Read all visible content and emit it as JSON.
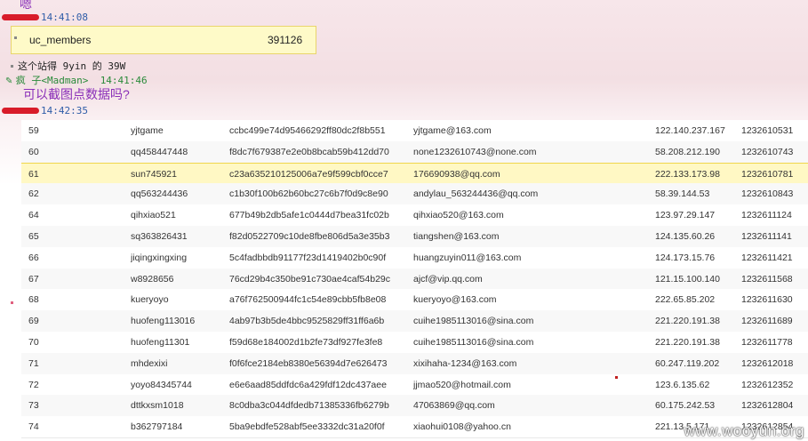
{
  "chat": {
    "top_fragment": "嗯",
    "time1": "14:41:08",
    "uc_box": {
      "name": "uc_members",
      "count": "391126"
    },
    "bullet_msg": "这个站得 9yin 的 39W",
    "madman_nick": "疯  子<Madman>",
    "madman_time": "14:41:46",
    "question": "可以截图点数据吗?",
    "time2": "14:42:35"
  },
  "table": {
    "rows": [
      {
        "id": "59",
        "username": "yjtgame",
        "hash": "ccbc499e74d95466292ff80dc2f8b551",
        "email": "yjtgame@163.com",
        "ip": "122.140.237.167",
        "ts": "1232610531"
      },
      {
        "id": "60",
        "username": "qq458447448",
        "hash": "f8dc7f679387e2e0b8bcab59b412dd70",
        "email": "none1232610743@none.com",
        "ip": "58.208.212.190",
        "ts": "1232610743"
      },
      {
        "id": "61",
        "username": "sun745921",
        "hash": "c23a635210125006a7e9f599cbf0cce7",
        "email": "176690938@qq.com",
        "ip": "222.133.173.98",
        "ts": "1232610781"
      },
      {
        "id": "62",
        "username": "qq563244436",
        "hash": "c1b30f100b62b60bc27c6b7f0d9c8e90",
        "email": "andylau_563244436@qq.com",
        "ip": "58.39.144.53",
        "ts": "1232610843"
      },
      {
        "id": "64",
        "username": "qihxiao521",
        "hash": "677b49b2db5afe1c0444d7bea31fc02b",
        "email": "qihxiao520@163.com",
        "ip": "123.97.29.147",
        "ts": "1232611124"
      },
      {
        "id": "65",
        "username": "sq363826431",
        "hash": "f82d0522709c10de8fbe806d5a3e35b3",
        "email": "tiangshen@163.com",
        "ip": "124.135.60.26",
        "ts": "1232611141"
      },
      {
        "id": "66",
        "username": "jiqingxingxing",
        "hash": "5c4fadbbdb91177f23d1419402b0c90f",
        "email": "huangzuyin011@163.com",
        "ip": "124.173.15.76",
        "ts": "1232611421"
      },
      {
        "id": "67",
        "username": "w8928656",
        "hash": "76cd29b4c350be91c730ae4caf54b29c",
        "email": "ajcf@vip.qq.com",
        "ip": "121.15.100.140",
        "ts": "1232611568"
      },
      {
        "id": "68",
        "username": "kueryoyo",
        "hash": "a76f762500944fc1c54e89cbb5fb8e08",
        "email": "kueryoyo@163.com",
        "ip": "222.65.85.202",
        "ts": "1232611630"
      },
      {
        "id": "69",
        "username": "huofeng113016",
        "hash": "4ab97b3b5de4bbc9525829ff31ff6a6b",
        "email": "cuihe1985113016@sina.com",
        "ip": "221.220.191.38",
        "ts": "1232611689"
      },
      {
        "id": "70",
        "username": "huofeng11301",
        "hash": "f59d68e184002d1b2fe73df927fe3fe8",
        "email": "cuihe1985113016@sina.com",
        "ip": "221.220.191.38",
        "ts": "1232611778"
      },
      {
        "id": "71",
        "username": "mhdexixi",
        "hash": "f0f6fce2184eb8380e56394d7e626473",
        "email": "xixihaha-1234@163.com",
        "ip": "60.247.119.202",
        "ts": "1232612018"
      },
      {
        "id": "72",
        "username": "yoyo84345744",
        "hash": "e6e6aad85ddfdc6a429fdf12dc437aee",
        "email": "jjmao520@hotmail.com",
        "ip": "123.6.135.62",
        "ts": "1232612352"
      },
      {
        "id": "73",
        "username": "dttkxsm1018",
        "hash": "8c0dba3c044dfdedb71385336fb6279b",
        "email": "47063869@qq.com",
        "ip": "60.175.242.53",
        "ts": "1232612804"
      },
      {
        "id": "74",
        "username": "b362797184",
        "hash": "5ba9ebdfe528abf5ee3332dc31a20f0f",
        "email": "xiaohui0108@yahoo.cn",
        "ip": "221.13.5.171",
        "ts": "1232612854"
      }
    ],
    "highlight_index": 2
  },
  "watermark": "www.wooyun.org",
  "colors": {
    "nick_red": "#d81c2a",
    "highlight": "#fff8c4",
    "time_blue": "#2f5da8",
    "question_purple": "#8a2fb8"
  }
}
